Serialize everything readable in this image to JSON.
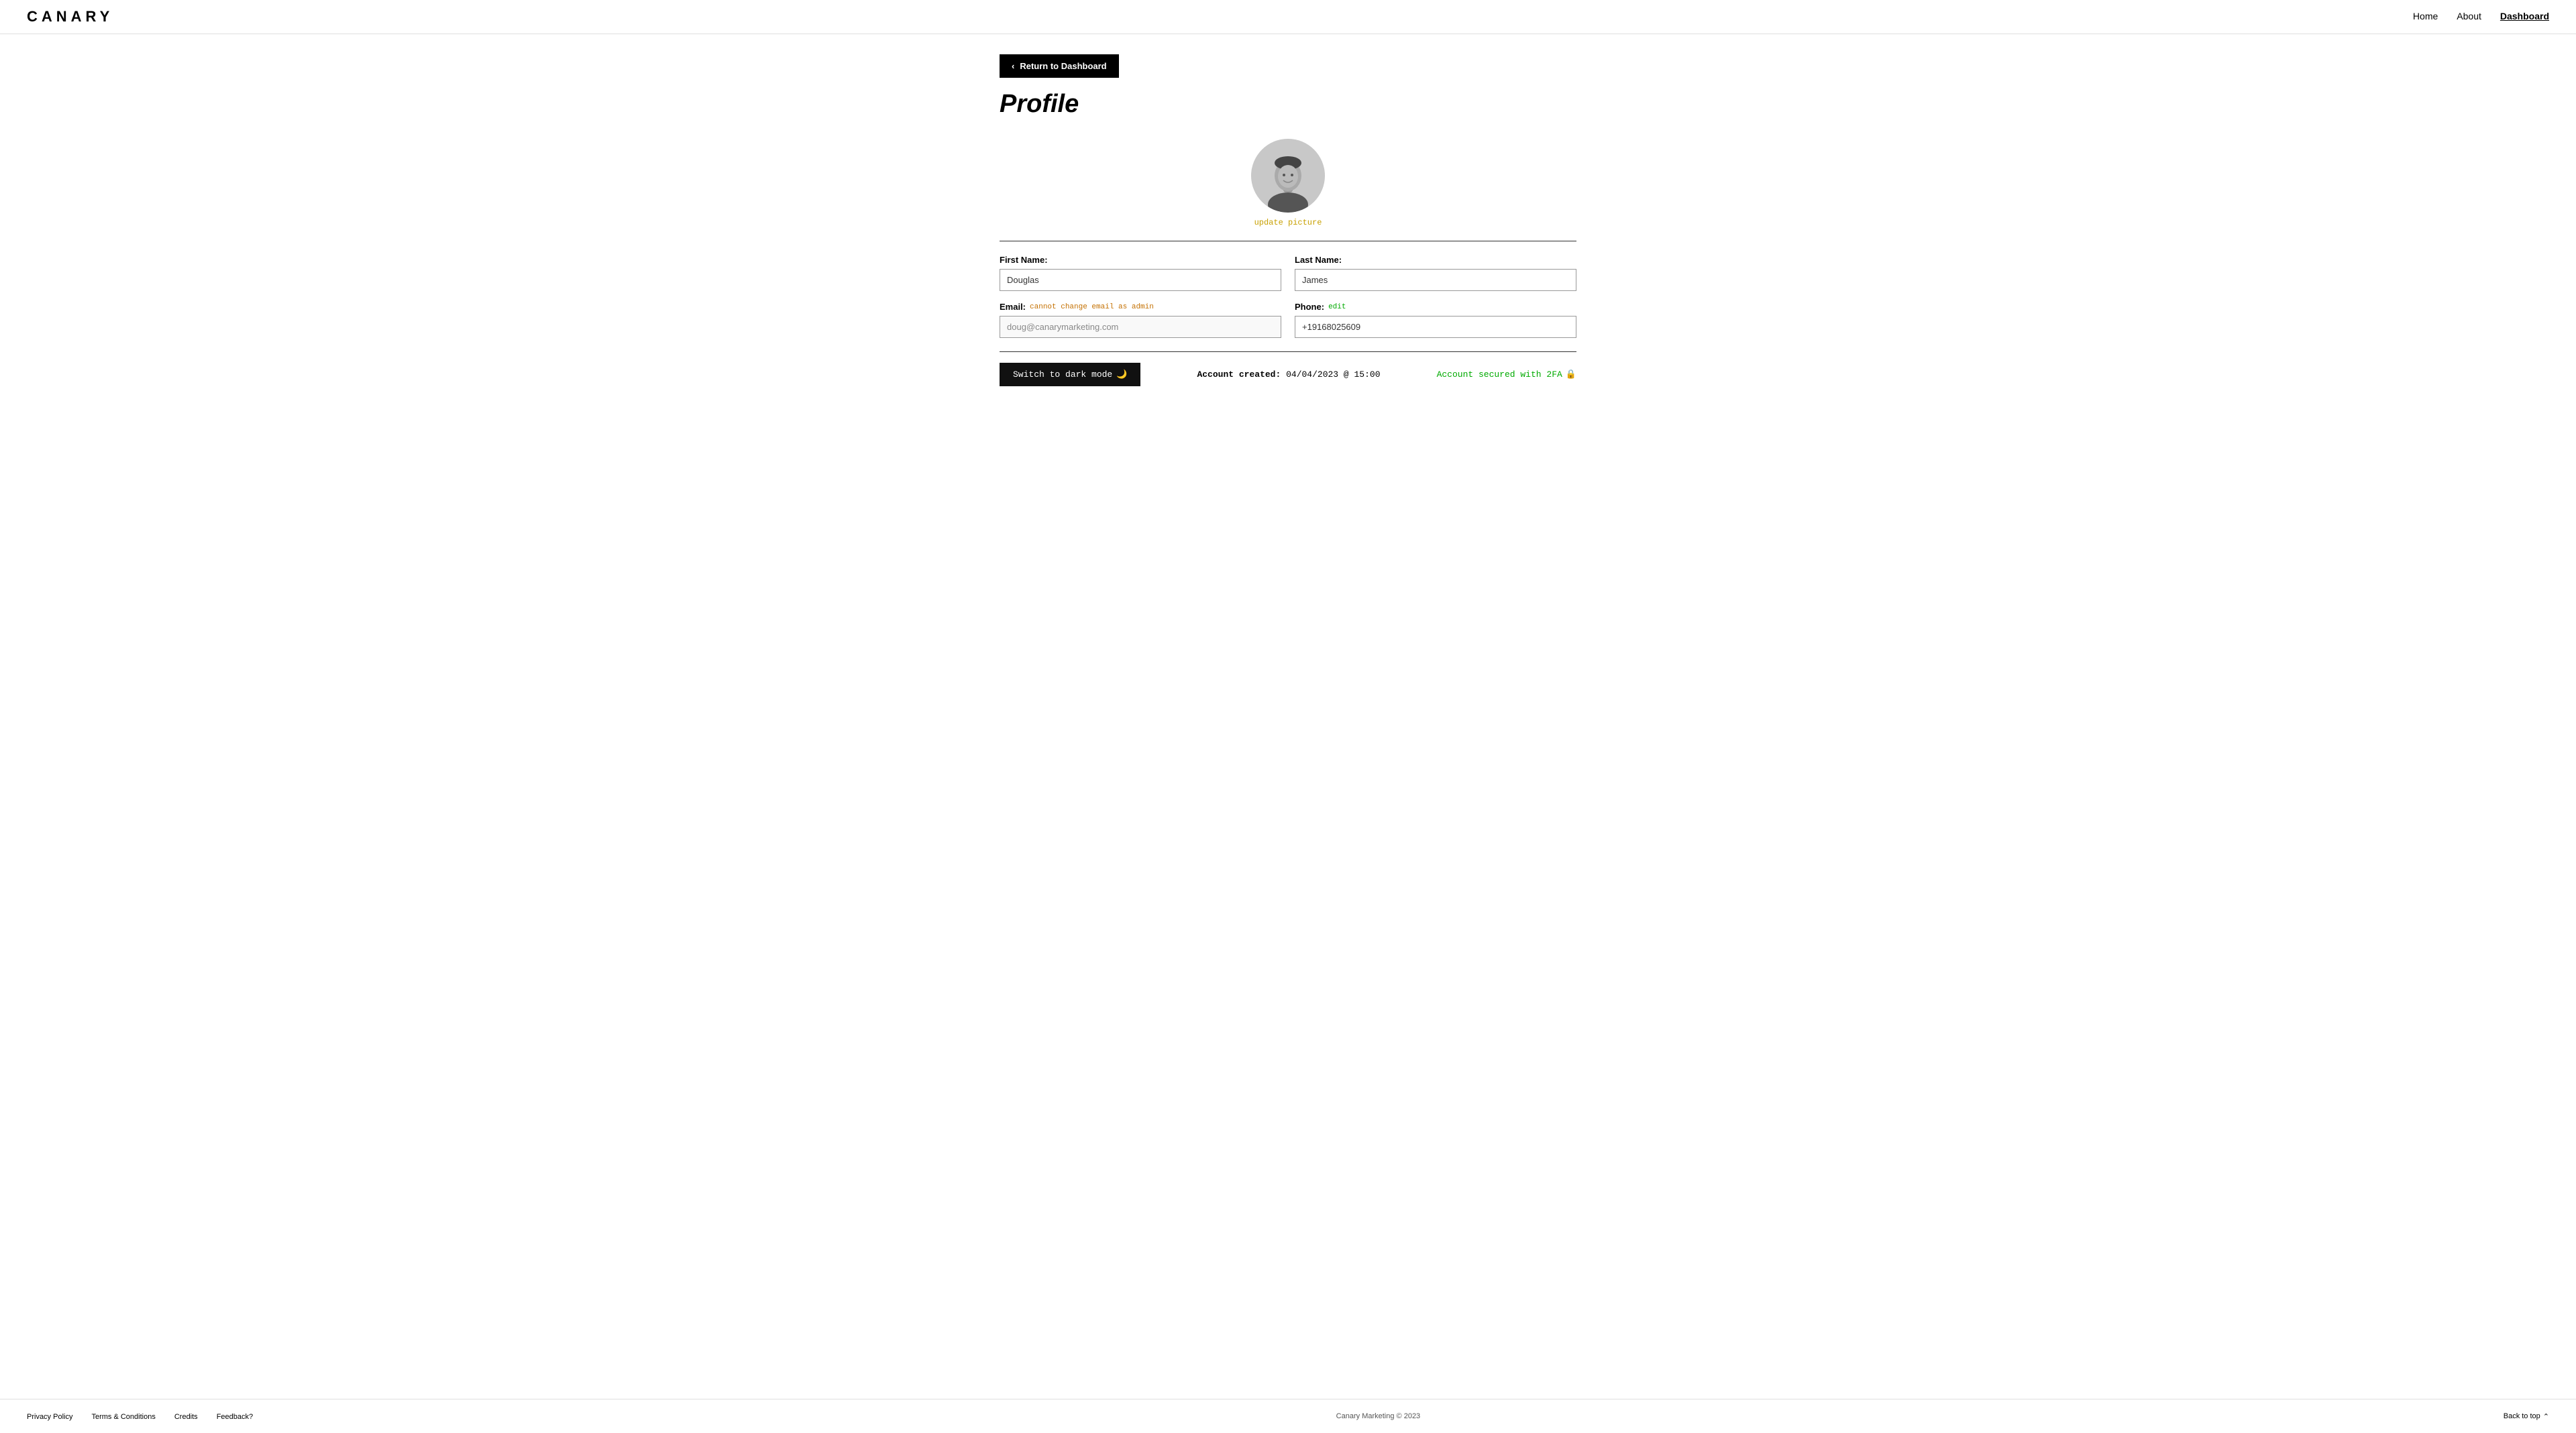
{
  "nav": {
    "logo": "CANARY",
    "links": [
      {
        "label": "Home",
        "active": false
      },
      {
        "label": "About",
        "active": false
      },
      {
        "label": "Dashboard",
        "active": true
      }
    ]
  },
  "page": {
    "return_btn_label": "Return to Dashboard",
    "title": "Profile",
    "update_picture_label": "update picture"
  },
  "form": {
    "first_name_label": "First Name:",
    "first_name_value": "Douglas",
    "last_name_label": "Last Name:",
    "last_name_value": "James",
    "email_label": "Email:",
    "email_cannot_change": "cannot change email as admin",
    "email_value": "doug@canarymarketing.com",
    "phone_label": "Phone:",
    "phone_edit": "edit",
    "phone_value": "+19168025609"
  },
  "bottom": {
    "dark_mode_btn": "Switch to dark mode",
    "dark_mode_icon": "🌙",
    "account_created_label": "Account created:",
    "account_created_value": "04/04/2023 @ 15:00",
    "account_secured_text": "Account secured with 2FA",
    "account_secured_icon": "🔒"
  },
  "footer": {
    "links": [
      {
        "label": "Privacy Policy"
      },
      {
        "label": "Terms & Conditions"
      },
      {
        "label": "Credits"
      },
      {
        "label": "Feedback?"
      }
    ],
    "copyright": "Canary Marketing © 2023",
    "back_to_top": "Back to top"
  }
}
